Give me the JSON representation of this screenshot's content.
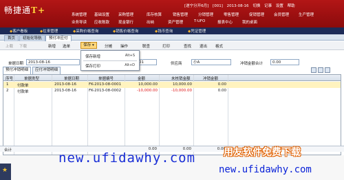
{
  "app": {
    "logo_text": "畅捷通",
    "logo_suffix": "T+",
    "status": {
      "account": "[遂宁分开6月]",
      "user": "[001]",
      "date": "2013-08-16",
      "switch": "切换",
      "note": "记事",
      "settings": "设置",
      "help": "帮助"
    },
    "menu_row1": [
      "系统管理",
      "基础设置",
      "采购管理",
      "库存核算",
      "销售管理",
      "分销管理",
      "零售管理",
      "促销管理",
      "会员管理",
      "生产管理"
    ],
    "menu_row2": [
      "业务导读",
      "应收账款",
      "现金银行",
      "出纳",
      "资产管理",
      "T-UFO",
      "报表中心",
      "我的桌面"
    ]
  },
  "navstrip": [
    "客户看板",
    "往来管理",
    "采购价格查询",
    "销售价格查询",
    "钱币查询",
    "凭证管理"
  ],
  "tabs": [
    "首页",
    "初始化导航",
    "预付冲应付"
  ],
  "toolbar": {
    "items": [
      "上载",
      "下载",
      "新增",
      "选单",
      "保存",
      "分摊",
      "操作",
      "联查",
      "打印",
      "查找",
      "退出",
      "格式"
    ]
  },
  "save_dropdown": {
    "items": [
      {
        "label": "保存新增",
        "key": "Alt+S"
      },
      {
        "label": "保存打印",
        "key": "Alt+D"
      }
    ]
  },
  "form": {
    "date_label": "单据日期",
    "date_value": "2013-08-16",
    "code_value": "-0001",
    "supplier_label": "供应商",
    "supplier_value": "小A",
    "total_label": "冲销金额合计",
    "total_value": "0.00"
  },
  "subtabs": [
    "预付冲销明细",
    "应付冲销明细"
  ],
  "table": {
    "columns": [
      "序号",
      "单据类型",
      "单据日期",
      "单据编号",
      "金额",
      "未核销金额",
      "冲销金额"
    ],
    "rows": [
      {
        "no": "1",
        "type": "付款单",
        "date": "2013-08-16",
        "code": "FK-2013-08-0001",
        "amount": "10,000.00",
        "unsettled": "10,000.00",
        "writeoff": "0.00"
      },
      {
        "no": "2",
        "type": "付款单",
        "date": "2013-08-16",
        "code": "FK-2013-08-0002",
        "amount": "-10,000.00",
        "unsettled": "-10,000.00",
        "writeoff": "0.00"
      }
    ],
    "totals_label": "合计",
    "totals": [
      "0.00",
      "0.00",
      "0.00"
    ]
  },
  "watermarks": {
    "url_left": "new.ufidawhy.com",
    "title_right": "用友软件免费下载",
    "url_right": "new.ufidawhy.com"
  },
  "colors": {
    "banner": "#a51213",
    "nav": "#1d2b57",
    "accent": "#ffd77a"
  }
}
